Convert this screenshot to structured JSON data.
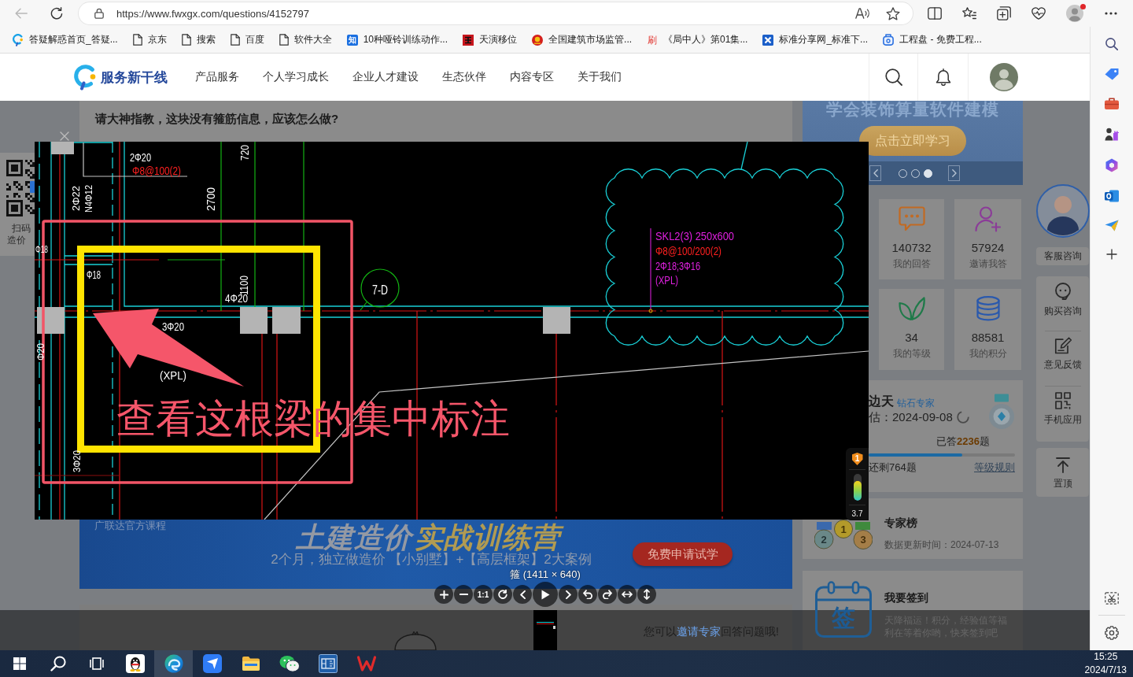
{
  "browser": {
    "back_disabled": true,
    "url": "https://www.fwxgx.com/questions/4152797",
    "profile_alert": true,
    "bookmarks": [
      {
        "kind": "logo",
        "label": "答疑解惑首页_答疑..."
      },
      {
        "kind": "page",
        "label": "京东"
      },
      {
        "kind": "page",
        "label": "搜索"
      },
      {
        "kind": "page",
        "label": "百度"
      },
      {
        "kind": "page",
        "label": "软件大全"
      },
      {
        "kind": "glyph",
        "glyph": "知",
        "label": "10种哑铃训练动作..."
      },
      {
        "kind": "tile",
        "label": "天演移位"
      },
      {
        "kind": "emblem",
        "label": "全国建筑市场监管..."
      },
      {
        "kind": "glyph-plain",
        "glyph": "刷",
        "label": "《局中人》第01集..."
      },
      {
        "kind": "cross",
        "label": "标准分享网_标准下..."
      },
      {
        "kind": "cup",
        "label": "工程盘 - 免费工程..."
      }
    ]
  },
  "site_header": {
    "logo": "服务新干线",
    "nav": [
      "产品服务",
      "个人学习成长",
      "企业人才建设",
      "生态伙伴",
      "内容专区",
      "关于我们"
    ]
  },
  "question": {
    "title": "请大神指教，这块没有箍筋信息，应该怎么做?"
  },
  "qr_panel": {
    "lines": [
      "扫码",
      "造价"
    ]
  },
  "promo": {
    "title": "学会装饰算量软件建模",
    "button": "点击立即学习",
    "slides": [
      {
        "selected": false
      },
      {
        "selected": false
      },
      {
        "selected": true
      }
    ]
  },
  "stats": [
    {
      "kind": "chat",
      "value": "140732",
      "label": "我的回答"
    },
    {
      "kind": "invite",
      "value": "57924",
      "label": "邀请我答"
    },
    {
      "kind": "leaf",
      "value": "34",
      "label": "我的等级"
    },
    {
      "kind": "coins",
      "value": "88581",
      "label": "我的积分"
    }
  ],
  "expert": {
    "name": "边天",
    "badge": "钻石专家",
    "date": "估：2024-09-08",
    "answered": "已答**2236**题",
    "progress": {
      "level": 0.64
    },
    "remaining": "还剩764题",
    "rules_link": "等级规则"
  },
  "ranking": {
    "medals": [
      "2",
      "1",
      "3"
    ],
    "title": "专家榜",
    "updated": "数据更新时间：2024-07-13"
  },
  "checkin": {
    "icon_text": "签",
    "title": "我要签到",
    "text": "天降福运！积分，经验值等福利在等着你哟，快来签到吧"
  },
  "float_tools": {
    "service": "客服咨询",
    "items": [
      {
        "kind": "headset",
        "label": "购买咨询"
      },
      {
        "kind": "edit",
        "label": "意见反馈"
      },
      {
        "kind": "qr",
        "label": "手机应用"
      }
    ],
    "top": "置顶"
  },
  "course_banner": {
    "tag": "广联达官方课程",
    "title_plain": "土建造价",
    "title_accent": "实战训练营",
    "subtitle": "2个月，独立做造价 【小别墅】+【高层框架】2大案例",
    "button": "免费申请试学"
  },
  "answers": {
    "prompt_before": "您可以",
    "link": "邀请专家",
    "prompt_after": "回答问题哦!"
  },
  "viewer": {
    "cad_labels": [
      {
        "text": "2Φ20",
        "color": "#ffffff"
      },
      {
        "text": "Φ8@100(2)",
        "color": "#ff2020"
      },
      {
        "text": "720",
        "color": "#ffffff"
      },
      {
        "text": "2700",
        "color": "#ffffff"
      },
      {
        "text": "2Φ22",
        "color": "#ffffff"
      },
      {
        "text": "N4Φ12",
        "color": "#ffffff"
      },
      {
        "text": "Φ18",
        "color": "#ffffff"
      },
      {
        "text": "Φ18",
        "color": "#ffffff"
      },
      {
        "text": "1100",
        "color": "#ffffff"
      },
      {
        "text": "4Φ20",
        "color": "#ffffff"
      },
      {
        "text": "3Φ20",
        "color": "#ffffff"
      },
      {
        "text": "(XPL)",
        "color": "#ffffff"
      },
      {
        "text": "Φ20",
        "color": "#ffffff"
      },
      {
        "text": "3Φ20",
        "color": "#ffffff"
      },
      {
        "text": "SKL2(3) 250x600",
        "color": "#e020e0"
      },
      {
        "text": "Φ8@100/200(2)",
        "color": "#ff2020"
      },
      {
        "text": "2Φ18;3Φ16",
        "color": "#e020e0"
      },
      {
        "text": "(XPL)",
        "color": "#e020e0"
      }
    ],
    "axis_bubble": "7-D",
    "annotation": "查看这根梁的集中标注",
    "caption": "箍 (1411 × 640)",
    "tools": [
      {
        "kind": "zoom-in"
      },
      {
        "kind": "zoom-out"
      },
      {
        "kind": "one-to-one",
        "label": "1:1"
      },
      {
        "kind": "reset"
      },
      {
        "kind": "prev"
      },
      {
        "kind": "play"
      },
      {
        "kind": "next"
      },
      {
        "kind": "rotate-left"
      },
      {
        "kind": "rotate-right"
      },
      {
        "kind": "flip-h"
      },
      {
        "kind": "flip-v"
      }
    ],
    "widget": {
      "badge": "1",
      "level": 0.75,
      "reading": "3.7"
    }
  },
  "taskbar": {
    "apps": [
      {
        "kind": "start",
        "selected": false
      },
      {
        "kind": "search",
        "selected": false
      },
      {
        "kind": "task-view",
        "selected": false
      },
      {
        "kind": "penguin",
        "selected": false
      },
      {
        "kind": "browser",
        "selected": true
      },
      {
        "kind": "tile",
        "selected": false
      },
      {
        "kind": "folder",
        "selected": false
      },
      {
        "kind": "chat",
        "selected": false
      },
      {
        "kind": "blueprint",
        "selected": false
      },
      {
        "kind": "office",
        "selected": false
      }
    ],
    "time": "15:25",
    "date": "2024/7/13"
  }
}
